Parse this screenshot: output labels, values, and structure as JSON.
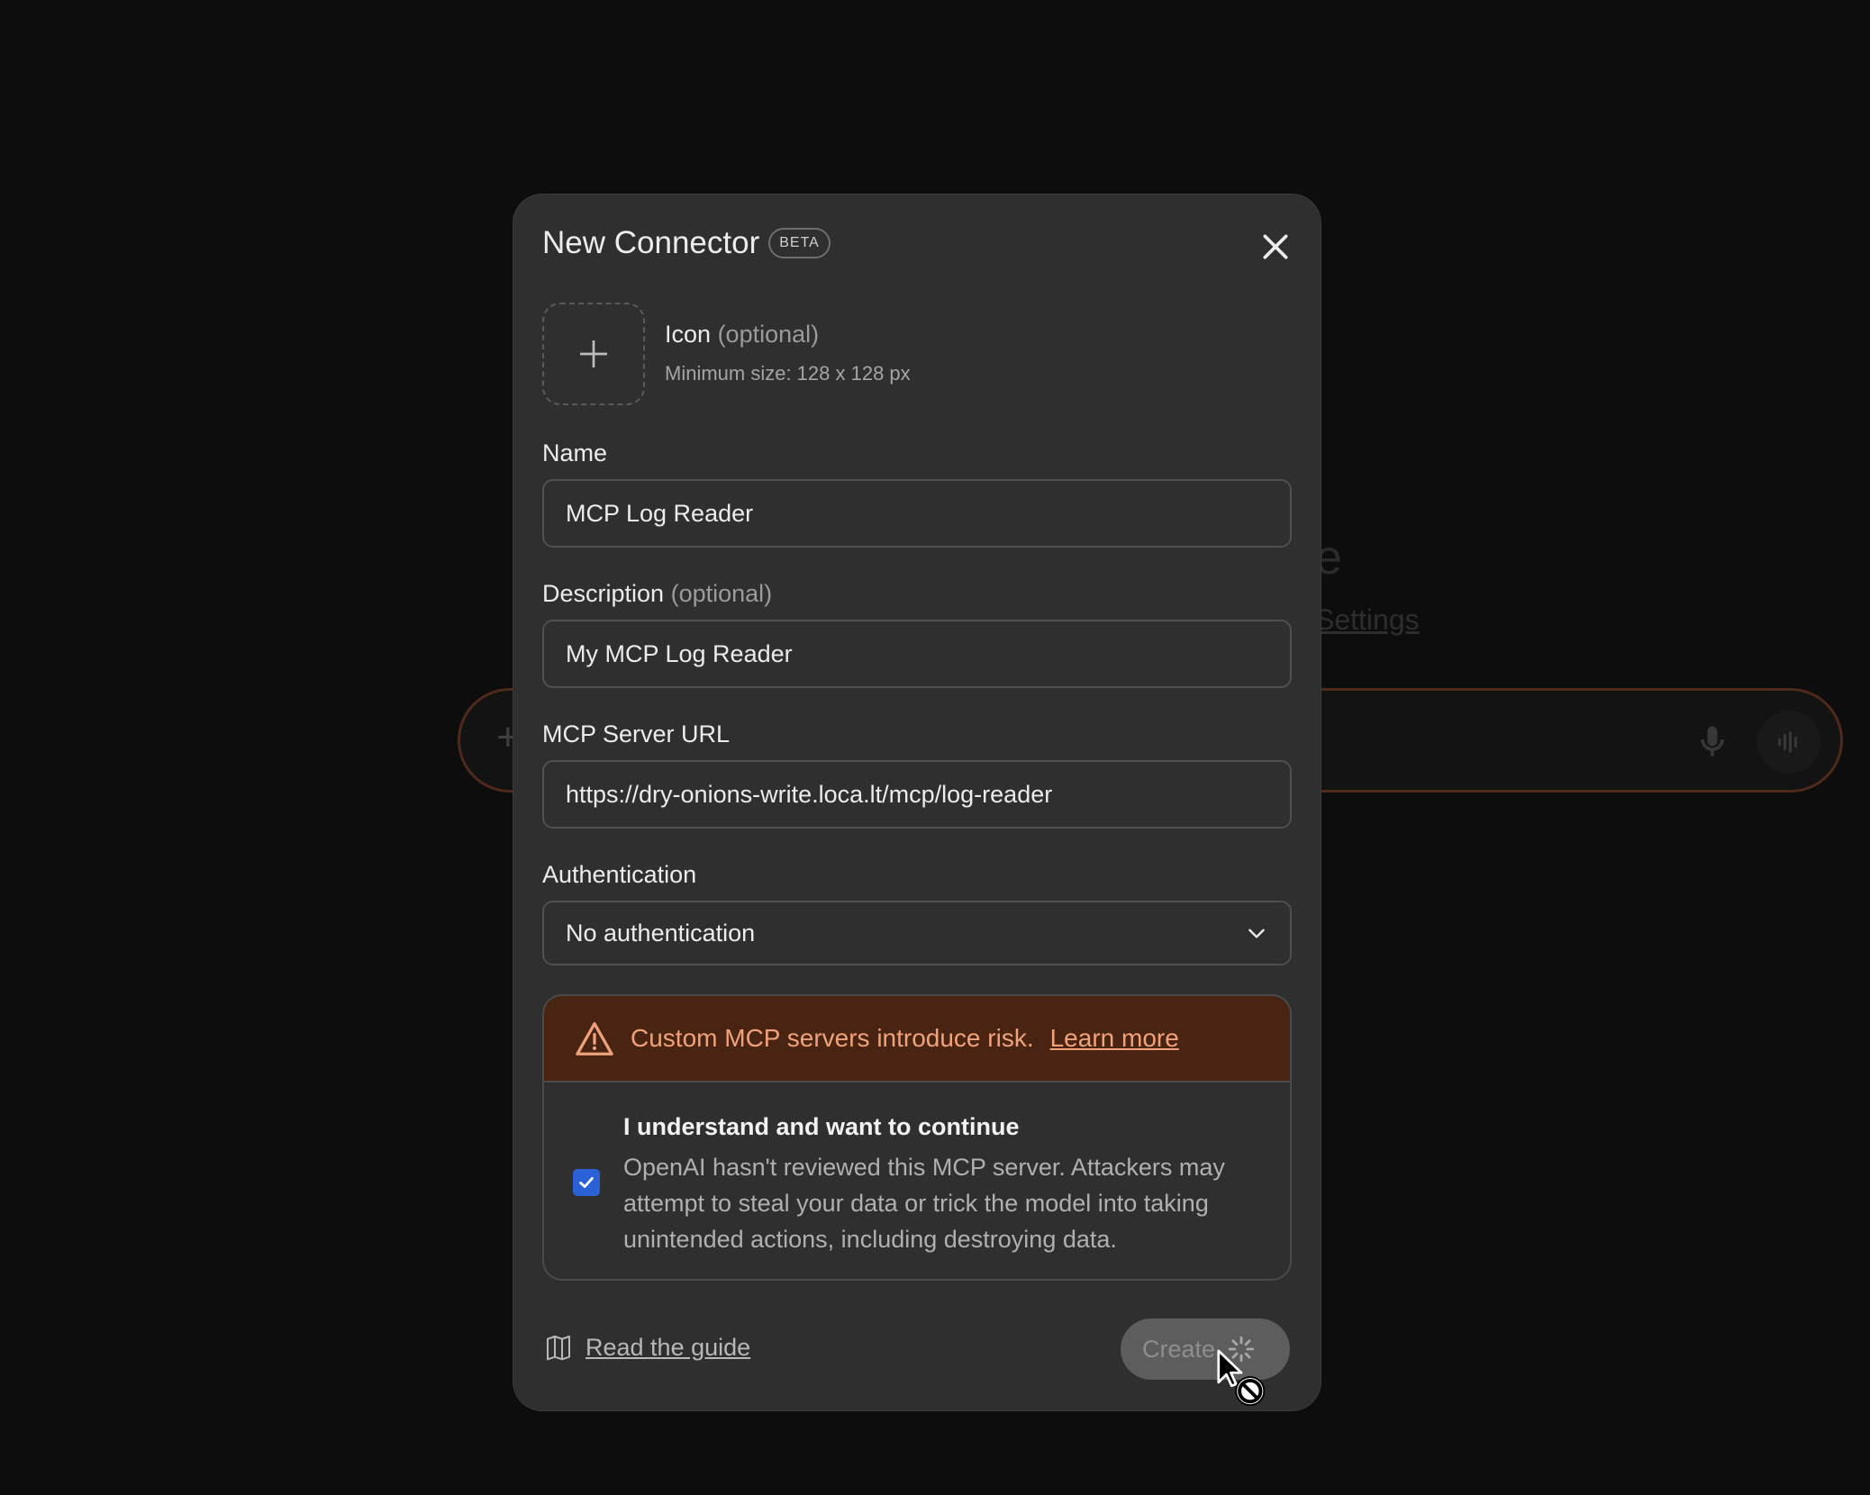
{
  "background": {
    "heading_fragment": "e",
    "link_fragment": "Settings"
  },
  "modal": {
    "title": "New Connector",
    "badge": "BETA",
    "icon": {
      "label": "Icon",
      "optional": "(optional)",
      "hint": "Minimum size: 128 x 128 px"
    },
    "name": {
      "label": "Name",
      "value": "MCP Log Reader"
    },
    "description": {
      "label": "Description",
      "optional": "(optional)",
      "value": "My MCP Log Reader"
    },
    "server_url": {
      "label": "MCP Server URL",
      "value": "https://dry-onions-write.loca.lt/mcp/log-reader"
    },
    "authentication": {
      "label": "Authentication",
      "selected": "No authentication"
    },
    "warning": {
      "text": "Custom MCP servers introduce risk.",
      "link": "Learn more",
      "color": "#f0a27a",
      "background": "#4a2412"
    },
    "consent": {
      "checked": true,
      "title": "I understand and want to continue",
      "body": "OpenAI hasn't reviewed this MCP server. Attackers may attempt to steal your data or trick the model into taking unintended actions, including destroying data."
    },
    "footer": {
      "guide_link": "Read the guide",
      "create_label": "Create"
    }
  },
  "colors": {
    "checkbox": "#2a61d6",
    "composer_border": "#6a3823"
  }
}
